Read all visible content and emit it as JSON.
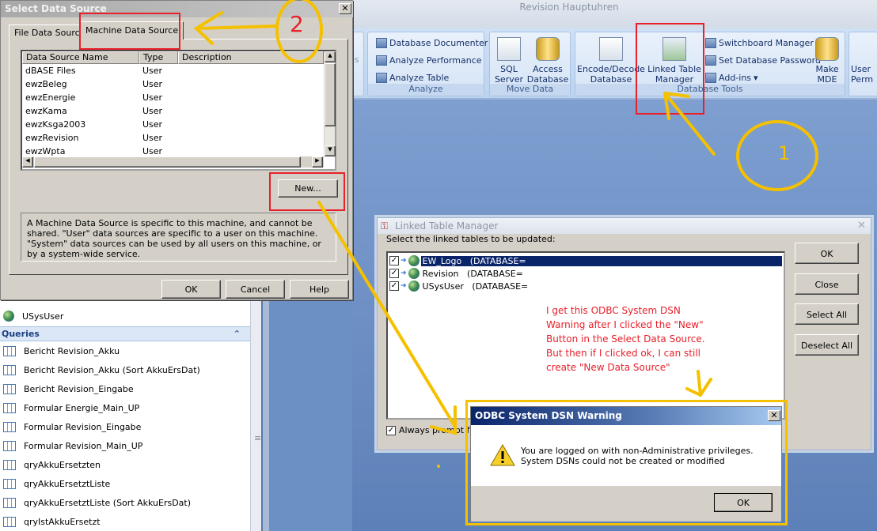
{
  "window": {
    "title": "Revision Hauptuhren"
  },
  "ribbon": {
    "partial_left": "es",
    "groups": [
      {
        "label": "Analyze",
        "items": [
          "Database Documenter",
          "Analyze Performance",
          "Analyze Table"
        ]
      },
      {
        "label": "Move Data",
        "items": [
          "SQL Server",
          "Access Database"
        ]
      },
      {
        "label": "Database Tools",
        "items": [
          "Encode/Decode Database",
          "Linked Table Manager",
          "Switchboard Manager",
          "Set Database Password",
          "Add-ins",
          "Make MDE"
        ]
      }
    ],
    "partial_right": "User Perm"
  },
  "nav": {
    "table_item": "USysUser",
    "queries_header": "Queries",
    "queries": [
      "Bericht Revision_Akku",
      "Bericht Revision_Akku (Sort AkkuErsDat)",
      "Bericht Revision_Eingabe",
      "Formular Energie_Main_UP",
      "Formular Revision_Eingabe",
      "Formular Revision_Main_UP",
      "qryAkkuErsetzten",
      "qryAkkuErsetztListe",
      "qryAkkuErsetztListe (Sort AkkuErsDat)",
      "qryIstAkkuErsetzt"
    ]
  },
  "select_data_source": {
    "title": "Select Data Source",
    "tabs": [
      "File Data Source",
      "Machine Data Source"
    ],
    "active_tab": "Machine Data Source",
    "columns": [
      "Data Source Name",
      "Type",
      "Description"
    ],
    "rows": [
      [
        "dBASE Files",
        "User",
        ""
      ],
      [
        "ewzBeleg",
        "User",
        ""
      ],
      [
        "ewzEnergie",
        "User",
        ""
      ],
      [
        "ewzKama",
        "User",
        ""
      ],
      [
        "ewzKsga2003",
        "User",
        ""
      ],
      [
        "ewzRevision",
        "User",
        ""
      ],
      [
        "ewzWpta",
        "User",
        ""
      ]
    ],
    "new_button": "New...",
    "info": "A Machine Data Source is specific to this machine, and cannot be shared. \"User\" data sources are specific to a user on this machine.  \"System\" data sources can be used by all users on this machine, or by a system-wide service.",
    "buttons": [
      "OK",
      "Cancel",
      "Help"
    ]
  },
  "linked_table_manager": {
    "title": "Linked Table Manager",
    "prompt": "Select the linked tables to be updated:",
    "tables": [
      {
        "name": "EW_Logo",
        "conn": "(DATABASE=",
        "checked": true,
        "selected": true
      },
      {
        "name": "Revision",
        "conn": "(DATABASE=",
        "checked": true,
        "selected": false
      },
      {
        "name": "USysUser",
        "conn": "(DATABASE=",
        "checked": true,
        "selected": false
      }
    ],
    "always_prompt": "Always prompt for",
    "buttons": [
      "OK",
      "Close",
      "Select All",
      "Deselect All"
    ]
  },
  "odbc_warning": {
    "title": "ODBC System DSN Warning",
    "message": "You are logged on with non-Administrative privileges. System DSNs could not be created or modified",
    "ok": "OK"
  },
  "annotations": {
    "step1": "1",
    "step2": "2",
    "note": "I get this ODBC System DSN Warning after I clicked the \"New\" Button in the Select Data Source. But then if I clicked ok, I can still create \"New Data Source\"",
    "annotation_color": "#f5c000",
    "highlight_color": "#e8202a"
  }
}
